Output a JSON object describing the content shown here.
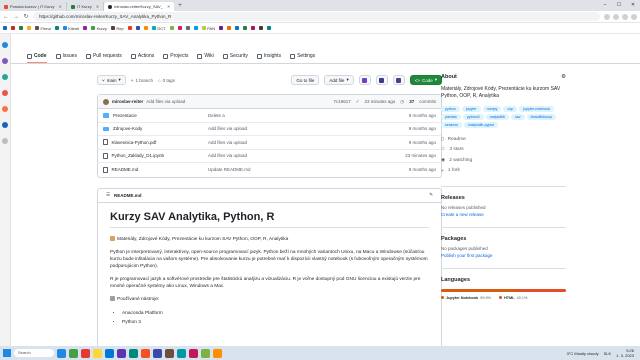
{
  "browser": {
    "tabs": [
      {
        "label": "Ponuka kurzov | IT Kurzy",
        "color": "#e34c26"
      },
      {
        "label": "IT Kurzy",
        "color": "#2e7d32"
      },
      {
        "label": "miroslav-reiter/Kurzy_SAV_",
        "color": "#24292f",
        "active": true
      }
    ],
    "new_tab": "+",
    "url": "https://github.com/miroslav-reiter/Kurzy_SAV_Analytika_Python_R",
    "window_controls": [
      "–",
      "☐",
      "✕"
    ],
    "bookmarks": [
      {
        "label": "",
        "color": "#1565c0"
      },
      {
        "label": "",
        "color": "#c62828"
      },
      {
        "label": "",
        "color": "#2e7d32"
      },
      {
        "label": "",
        "color": "#f9a825"
      },
      {
        "label": "Firma",
        "color": "#6d4c41"
      },
      {
        "label": "",
        "color": "#00897b"
      },
      {
        "label": "Klienti",
        "color": "#1e88e5"
      },
      {
        "label": "",
        "color": "#8e24aa"
      },
      {
        "label": "Kurzy",
        "color": "#43a047"
      },
      {
        "label": "Rep",
        "color": "#5d4037"
      },
      {
        "label": "",
        "color": "#e53935"
      },
      {
        "label": "",
        "color": "#3949ab"
      },
      {
        "label": "",
        "color": "#fb8c00"
      },
      {
        "label": "GCT",
        "color": "#00acc1"
      },
      {
        "label": "",
        "color": "#7cb342"
      },
      {
        "label": "",
        "color": "#d81b60"
      },
      {
        "label": "",
        "color": "#546e7a"
      },
      {
        "label": "",
        "color": "#039be5"
      },
      {
        "label": "PAN",
        "color": "#c0ca33"
      },
      {
        "label": "",
        "color": "#6a1b9a"
      },
      {
        "label": "",
        "color": "#ef6c00"
      },
      {
        "label": "",
        "color": "#0277bd"
      },
      {
        "label": "",
        "color": "#2e7d32"
      },
      {
        "label": "",
        "color": "#ad1457"
      },
      {
        "label": "",
        "color": "#4e342e"
      },
      {
        "label": "",
        "color": "#00838f"
      }
    ]
  },
  "repo_nav": [
    {
      "label": "Code",
      "icon": "code-icon",
      "active": true
    },
    {
      "label": "Issues",
      "icon": "issues-icon"
    },
    {
      "label": "Pull requests",
      "icon": "pull-request-icon"
    },
    {
      "label": "Actions",
      "icon": "actions-icon"
    },
    {
      "label": "Projects",
      "icon": "projects-icon"
    },
    {
      "label": "Wiki",
      "icon": "wiki-icon"
    },
    {
      "label": "Security",
      "icon": "shield-icon"
    },
    {
      "label": "Insights",
      "icon": "graph-icon"
    },
    {
      "label": "Settings",
      "icon": "gear-icon"
    }
  ],
  "toolbar": {
    "branch": "main",
    "branches": "1 branch",
    "tags": "0 tags",
    "go_to_file": "Go to file",
    "add_file": "Add file",
    "code": "Code"
  },
  "commit": {
    "user": "miroslav-reiter",
    "message": "Add files via upload",
    "hash": "7c19617",
    "time": "23 minutes ago",
    "count": "37",
    "commits_label": "commits"
  },
  "files": [
    {
      "name": "Prezentacie",
      "type": "dir",
      "message": "Delete a",
      "time": "9 months ago"
    },
    {
      "name": "Zdrojove-Kody",
      "type": "dir",
      "message": "Add files via upload",
      "time": "9 months ago"
    },
    {
      "name": "Klavesnica-Python.pdf",
      "type": "file",
      "message": "Add files via upload",
      "time": "9 months ago"
    },
    {
      "name": "Python_Zaklady_D1.ipynb",
      "type": "file",
      "message": "Add files via upload",
      "time": "23 minutes ago"
    },
    {
      "name": "README.md",
      "type": "file",
      "message": "Update README.md",
      "time": "9 months ago"
    }
  ],
  "readme": {
    "filename": "README.md",
    "title": "Kurzy SAV Analytika, Python, R",
    "tagline": "Materiály, Zdrojové Kódy, Prezentácie ku kurzom SAV Python, OOP, R, Analytika",
    "p1": "Python je interpretovaný, interaktívny, open-source programovací jazyk. Python beží na mnohých variantoch Unixu, na Macu a Windowse (súčasťou kurzu bude inštalácia na vašom systéme). Pre absolvovanie kurzu je potrebné mať k dispozícii vlastný notebook (s ľubovoľným operačným systémom podporujúcim Python).",
    "p2": "R je programovací jazyk a softvérové prostredie pre štatistickú analýzu a vizualizáciu. R je voľne dostupný pod GNU licenciou a existujú verzie pre mnohé operačné systémy ako Linux, Windows a Mac.",
    "tools_label": "Používané nástroje:",
    "tools": [
      "Anaconda Platform",
      "Python 3"
    ]
  },
  "about": {
    "title": "About",
    "description": "Materiály, Zdrojové Kódy, Prezentácie ku kurzom SAV Python, OOP, R, Analytika",
    "topics": [
      "python",
      "jupyter",
      "numpy",
      "oop",
      "jupyter-notebook",
      "pandas",
      "python3",
      "matplotlib",
      "sav",
      "beautifulsoup",
      "seaborn",
      "matplotlib-pyplot"
    ],
    "meta": [
      "Readme",
      "3 stars",
      "2 watching",
      "1 fork"
    ]
  },
  "releases": {
    "title": "Releases",
    "sub": "No releases published",
    "link": "Create a new release"
  },
  "packages": {
    "title": "Packages",
    "sub": "No packages published",
    "link": "Publish your first package"
  },
  "languages": {
    "title": "Languages",
    "items": [
      {
        "name": "Jupyter Notebook",
        "pct": "59.9%",
        "value": 59.9,
        "color": "#DA5B0B"
      },
      {
        "name": "HTML",
        "pct": "40.1%",
        "value": 40.1,
        "color": "#e34c26"
      }
    ]
  },
  "taskbar": {
    "search": "Search",
    "weather": "3°C  Mostly cloudy",
    "lang": "SLK",
    "time": "9:26",
    "date": "1. 3. 2023",
    "apps": [
      "#1e88e5",
      "#43a047",
      "#e53935",
      "#fdd835",
      "#0078d4",
      "#5e35b1",
      "#00897b",
      "#f4511e",
      "#3949ab",
      "#6d4c41",
      "#0097a7",
      "#c2185b",
      "#7cb342",
      "#ff8f00"
    ]
  }
}
